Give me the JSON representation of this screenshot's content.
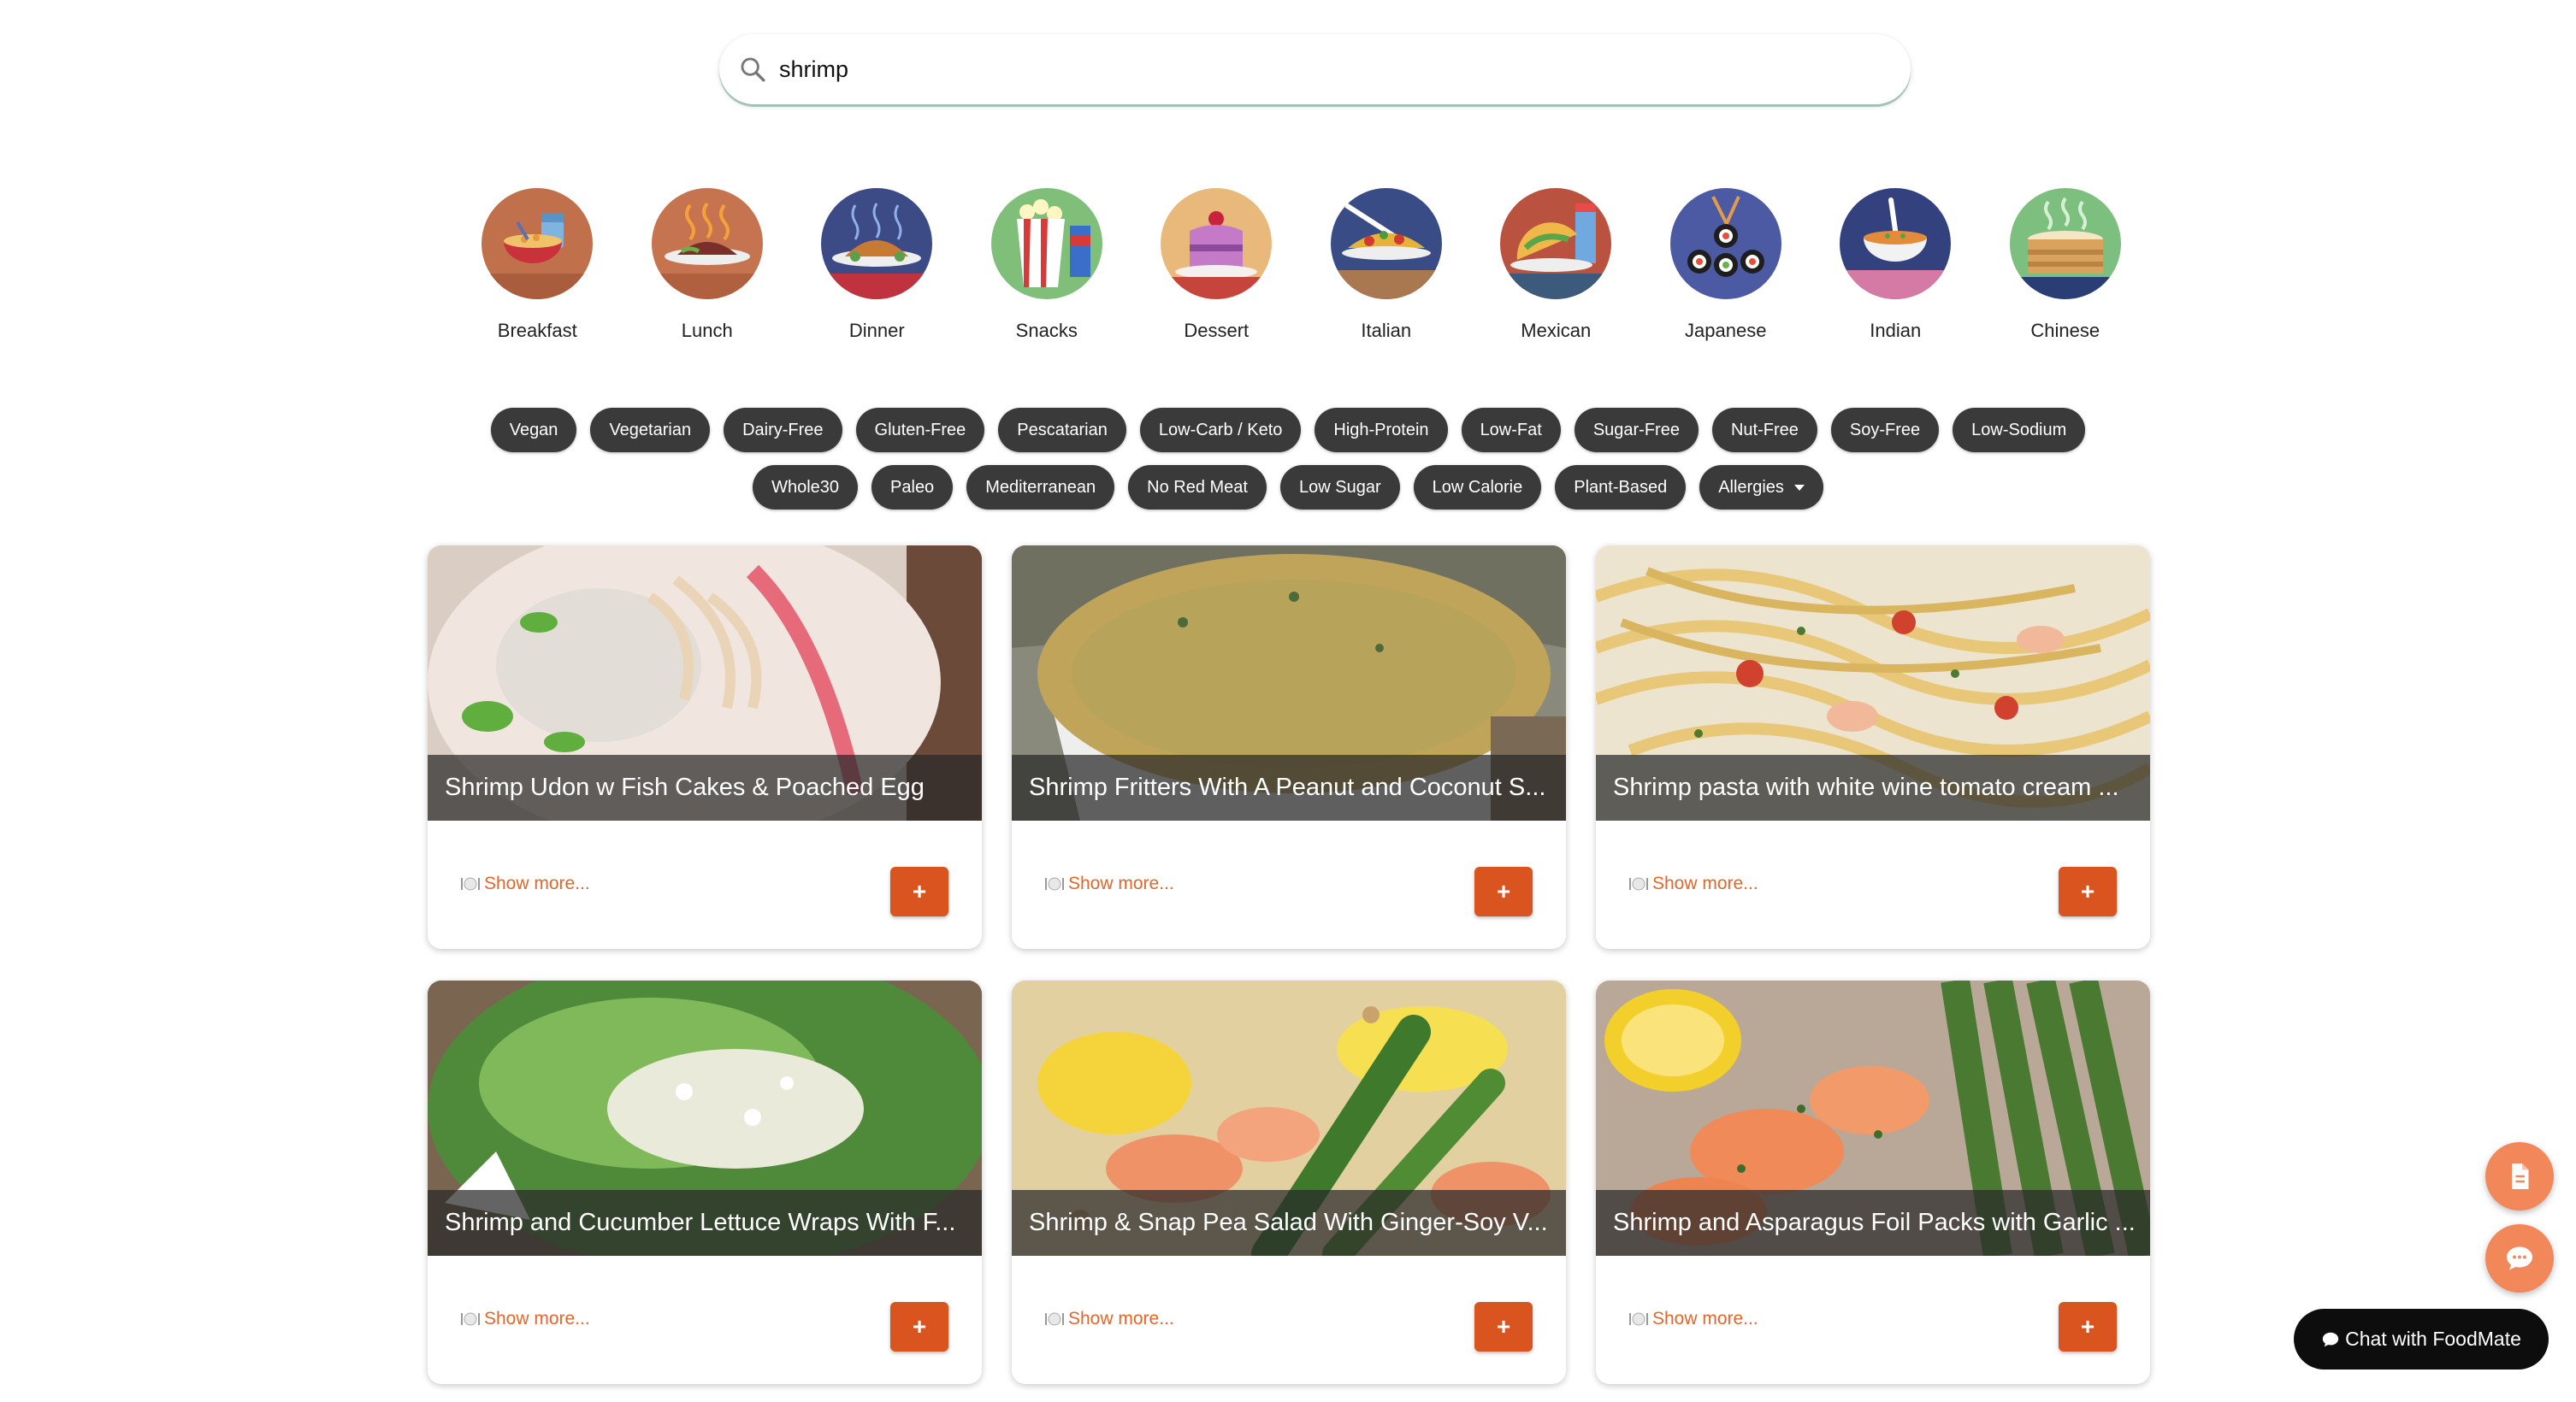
{
  "search": {
    "value": "shrimp",
    "icon": "search-icon"
  },
  "categories": [
    {
      "label": "Breakfast",
      "icon": "breakfast-icon",
      "bg": "#c0714b"
    },
    {
      "label": "Lunch",
      "icon": "lunch-icon",
      "bg": "#c6744f"
    },
    {
      "label": "Dinner",
      "icon": "dinner-icon",
      "bg": "#3c4a86"
    },
    {
      "label": "Snacks",
      "icon": "snacks-icon",
      "bg": "#7fbf7a"
    },
    {
      "label": "Dessert",
      "icon": "dessert-icon",
      "bg": "#e9b97c"
    },
    {
      "label": "Italian",
      "icon": "italian-icon",
      "bg": "#3a4c86"
    },
    {
      "label": "Mexican",
      "icon": "mexican-icon",
      "bg": "#b9523e"
    },
    {
      "label": "Japanese",
      "icon": "japanese-icon",
      "bg": "#4b5aa2"
    },
    {
      "label": "Indian",
      "icon": "indian-icon",
      "bg": "#33427e"
    },
    {
      "label": "Chinese",
      "icon": "chinese-icon",
      "bg": "#7dbf7f"
    }
  ],
  "diet_filters_row1": [
    "Vegan",
    "Vegetarian",
    "Dairy-Free",
    "Gluten-Free",
    "Pescatarian",
    "Low-Carb / Keto",
    "High-Protein",
    "Low-Fat",
    "Sugar-Free",
    "Nut-Free",
    "Soy-Free",
    "Low-Sodium"
  ],
  "diet_filters_row2": [
    "Whole30",
    "Paleo",
    "Mediterranean",
    "No Red Meat",
    "Low Sugar",
    "Low Calorie",
    "Plant-Based"
  ],
  "allergies_label": "Allergies",
  "recipes": [
    {
      "title": "Shrimp Udon w Fish Cakes & Poached Egg",
      "show_more": "Show more...",
      "add_label": "+"
    },
    {
      "title": "Shrimp Fritters With A Peanut and Coconut S...",
      "show_more": "Show more...",
      "add_label": "+"
    },
    {
      "title": "Shrimp pasta with white wine tomato cream ...",
      "show_more": "Show more...",
      "add_label": "+"
    },
    {
      "title": "Shrimp and Cucumber Lettuce Wraps With F...",
      "show_more": "Show more...",
      "add_label": "+"
    },
    {
      "title": "Shrimp & Snap Pea Salad With Ginger-Soy V...",
      "show_more": "Show more...",
      "add_label": "+"
    },
    {
      "title": "Shrimp and Asparagus Foil Packs with Garlic ...",
      "show_more": "Show more...",
      "add_label": "+"
    }
  ],
  "floating": {
    "document_icon": "document-icon",
    "chat_icon": "chat-bubble-icon",
    "chat_label": "Chat with FoodMate"
  },
  "colors": {
    "accent": "#d9541e",
    "link": "#e2672a",
    "chip_bg": "#3a3a3a",
    "fab": "#f2875a",
    "chat_button": "#0d0d0d"
  }
}
